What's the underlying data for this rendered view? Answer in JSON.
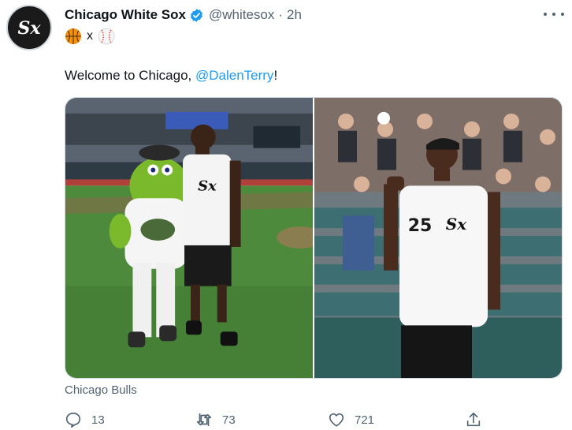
{
  "author": {
    "display_name": "Chicago White Sox",
    "handle": "@whitesox",
    "separator": "·",
    "time": "2h",
    "avatar_icon": "white-sox-logo",
    "verified_color": "#1d9bf0"
  },
  "subline": {
    "left_emoji": "basketball-icon",
    "connector": "x",
    "right_emoji": "baseball-icon"
  },
  "tweet": {
    "text_before": "Welcome to Chicago, ",
    "mention": "@DalenTerry",
    "text_after": "!"
  },
  "media": {
    "photos": [
      {
        "description_icon": "player-with-mascot-photo",
        "jersey_text": "SOX"
      },
      {
        "description_icon": "player-tossing-ball-photo",
        "jersey_number": "25"
      }
    ]
  },
  "source_label": "Chicago Bulls",
  "actions": {
    "reply_count": "13",
    "retweet_count": "73",
    "like_count": "721"
  },
  "colors": {
    "text": "#0f1419",
    "secondary": "#536471",
    "accent": "#1d9bf0",
    "border": "#cfd9de"
  }
}
